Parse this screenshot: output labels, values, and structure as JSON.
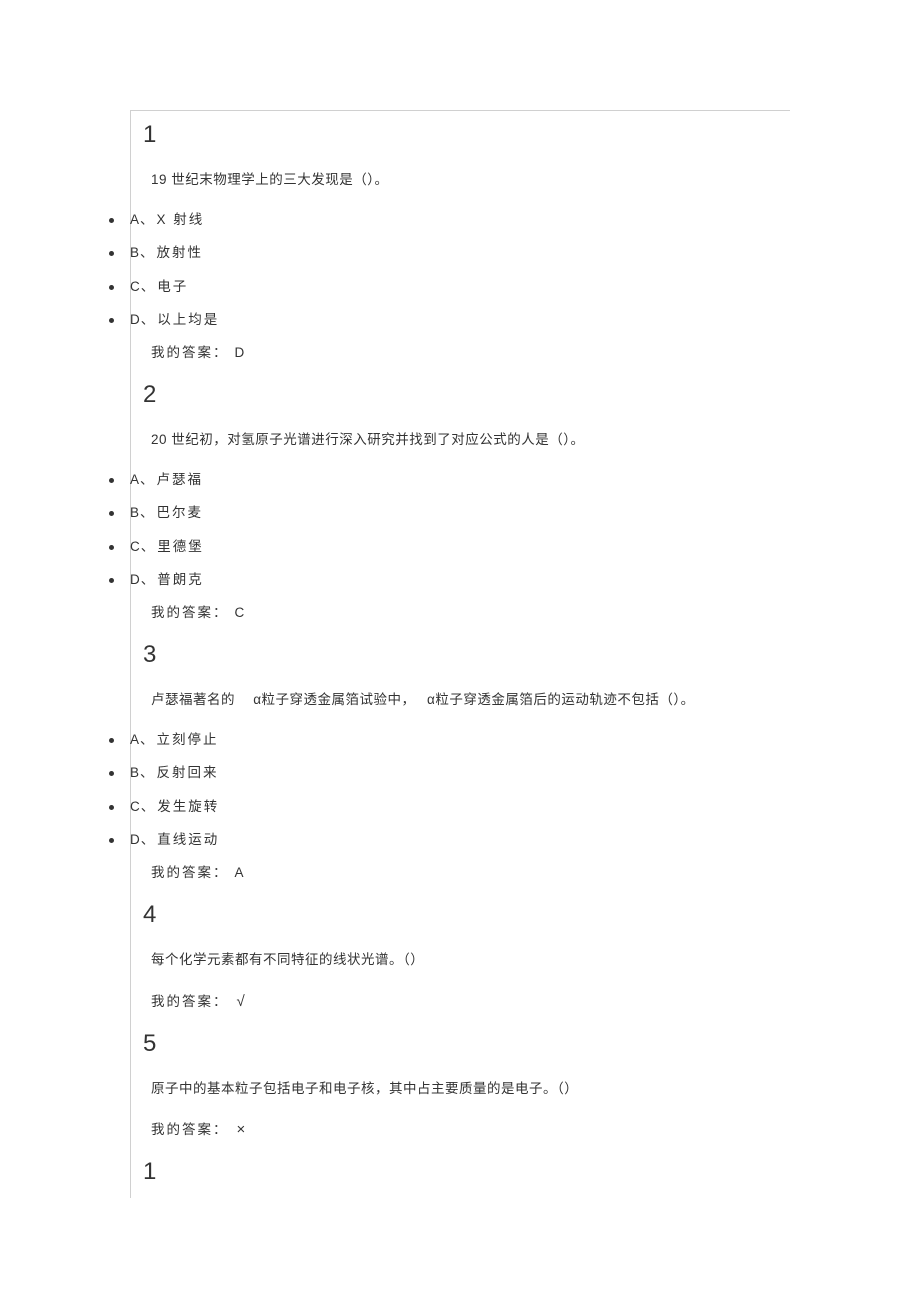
{
  "questions": [
    {
      "number": "1",
      "prompt": "19 世纪末物理学上的三大发现是（）。",
      "options": [
        {
          "letter": "A、",
          "text": "X 射线"
        },
        {
          "letter": "B、",
          "text": "放射性"
        },
        {
          "letter": "C、",
          "text": "电子"
        },
        {
          "letter": "D、",
          "text": "以上均是"
        }
      ],
      "answer_label": "我的答案：",
      "answer_value": "D"
    },
    {
      "number": "2",
      "prompt": "20 世纪初，对氢原子光谱进行深入研究并找到了对应公式的人是（）。",
      "options": [
        {
          "letter": "A、",
          "text": "卢瑟福"
        },
        {
          "letter": "B、",
          "text": "巴尔麦"
        },
        {
          "letter": "C、",
          "text": "里德堡"
        },
        {
          "letter": "D、",
          "text": "普朗克"
        }
      ],
      "answer_label": "我的答案：",
      "answer_value": "C"
    },
    {
      "number": "3",
      "prompt": "卢瑟福著名的　 α粒子穿透金属箔试验中，　 α粒子穿透金属箔后的运动轨迹不包括（）。",
      "options": [
        {
          "letter": "A、",
          "text": "立刻停止"
        },
        {
          "letter": "B、",
          "text": "反射回来"
        },
        {
          "letter": "C、",
          "text": "发生旋转"
        },
        {
          "letter": "D、",
          "text": "直线运动"
        }
      ],
      "answer_label": "我的答案：",
      "answer_value": "A"
    },
    {
      "number": "4",
      "prompt": "每个化学元素都有不同特征的线状光谱。（）",
      "options": [],
      "answer_label": "我的答案：",
      "answer_symbol": "√"
    },
    {
      "number": "5",
      "prompt": "原子中的基本粒子包括电子和电子核，其中占主要质量的是电子。（）",
      "options": [],
      "answer_label": "我的答案：",
      "answer_symbol": "×"
    },
    {
      "number": "1",
      "prompt": "",
      "options": [],
      "answer_label": "",
      "answer_value": ""
    }
  ]
}
